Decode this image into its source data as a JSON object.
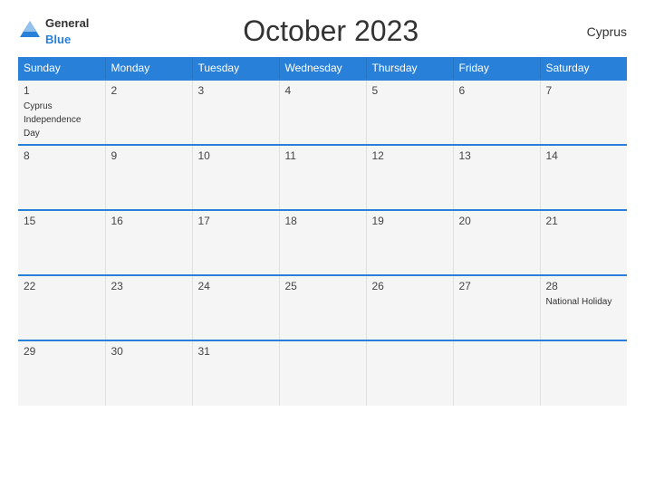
{
  "header": {
    "logo_general": "General",
    "logo_blue": "Blue",
    "title": "October 2023",
    "country": "Cyprus"
  },
  "weekdays": [
    "Sunday",
    "Monday",
    "Tuesday",
    "Wednesday",
    "Thursday",
    "Friday",
    "Saturday"
  ],
  "weeks": [
    [
      {
        "day": "1",
        "event": "Cyprus Independence Day"
      },
      {
        "day": "2",
        "event": ""
      },
      {
        "day": "3",
        "event": ""
      },
      {
        "day": "4",
        "event": ""
      },
      {
        "day": "5",
        "event": ""
      },
      {
        "day": "6",
        "event": ""
      },
      {
        "day": "7",
        "event": ""
      }
    ],
    [
      {
        "day": "8",
        "event": ""
      },
      {
        "day": "9",
        "event": ""
      },
      {
        "day": "10",
        "event": ""
      },
      {
        "day": "11",
        "event": ""
      },
      {
        "day": "12",
        "event": ""
      },
      {
        "day": "13",
        "event": ""
      },
      {
        "day": "14",
        "event": ""
      }
    ],
    [
      {
        "day": "15",
        "event": ""
      },
      {
        "day": "16",
        "event": ""
      },
      {
        "day": "17",
        "event": ""
      },
      {
        "day": "18",
        "event": ""
      },
      {
        "day": "19",
        "event": ""
      },
      {
        "day": "20",
        "event": ""
      },
      {
        "day": "21",
        "event": ""
      }
    ],
    [
      {
        "day": "22",
        "event": ""
      },
      {
        "day": "23",
        "event": ""
      },
      {
        "day": "24",
        "event": ""
      },
      {
        "day": "25",
        "event": ""
      },
      {
        "day": "26",
        "event": ""
      },
      {
        "day": "27",
        "event": ""
      },
      {
        "day": "28",
        "event": "National Holiday"
      }
    ],
    [
      {
        "day": "29",
        "event": ""
      },
      {
        "day": "30",
        "event": ""
      },
      {
        "day": "31",
        "event": ""
      },
      {
        "day": "",
        "event": ""
      },
      {
        "day": "",
        "event": ""
      },
      {
        "day": "",
        "event": ""
      },
      {
        "day": "",
        "event": ""
      }
    ]
  ]
}
